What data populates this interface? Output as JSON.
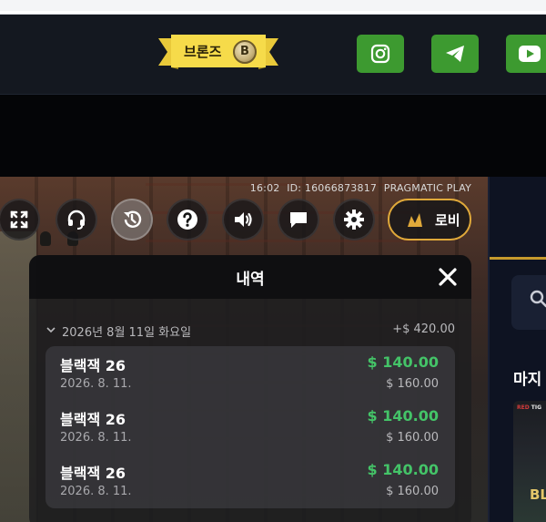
{
  "header": {
    "tier_badge": {
      "label": "브론즈",
      "coin_letter": "B"
    },
    "social": [
      {
        "icon": "instagram-icon"
      },
      {
        "icon": "telegram-icon"
      },
      {
        "icon": "youtube-icon"
      }
    ],
    "social_color": "#3d9a30"
  },
  "game": {
    "time": "16:02",
    "id": "ID: 16066873817",
    "provider": "PRAGMATIC PLAY",
    "controls": [
      {
        "icon": "fullscreen-icon"
      },
      {
        "icon": "headset-icon"
      },
      {
        "icon": "history-icon",
        "active": true
      },
      {
        "icon": "help-icon"
      },
      {
        "icon": "volume-icon"
      },
      {
        "icon": "chat-icon"
      },
      {
        "icon": "settings-icon"
      }
    ],
    "lobby_label": "로비",
    "accent_color": "#e0a93a"
  },
  "history_panel": {
    "title": "내역",
    "day": {
      "date": "2026년 8월 11일 화요일",
      "total": "+$ 420.00"
    },
    "items": [
      {
        "name": "블랙잭 26",
        "date": "2026. 8. 11.",
        "win": "$ 140.00",
        "bet": "$ 160.00"
      },
      {
        "name": "블랙잭 26",
        "date": "2026. 8. 11.",
        "win": "$ 140.00",
        "bet": "$ 160.00"
      },
      {
        "name": "블랙잭 26",
        "date": "2026. 8. 11.",
        "win": "$ 140.00",
        "bet": "$ 160.00"
      }
    ],
    "win_color": "#44c468"
  },
  "sidebar": {
    "heading": "마지",
    "thumb_brand_red": "RED",
    "thumb_brand_rest": "TIG",
    "thumb_text": "BL"
  }
}
